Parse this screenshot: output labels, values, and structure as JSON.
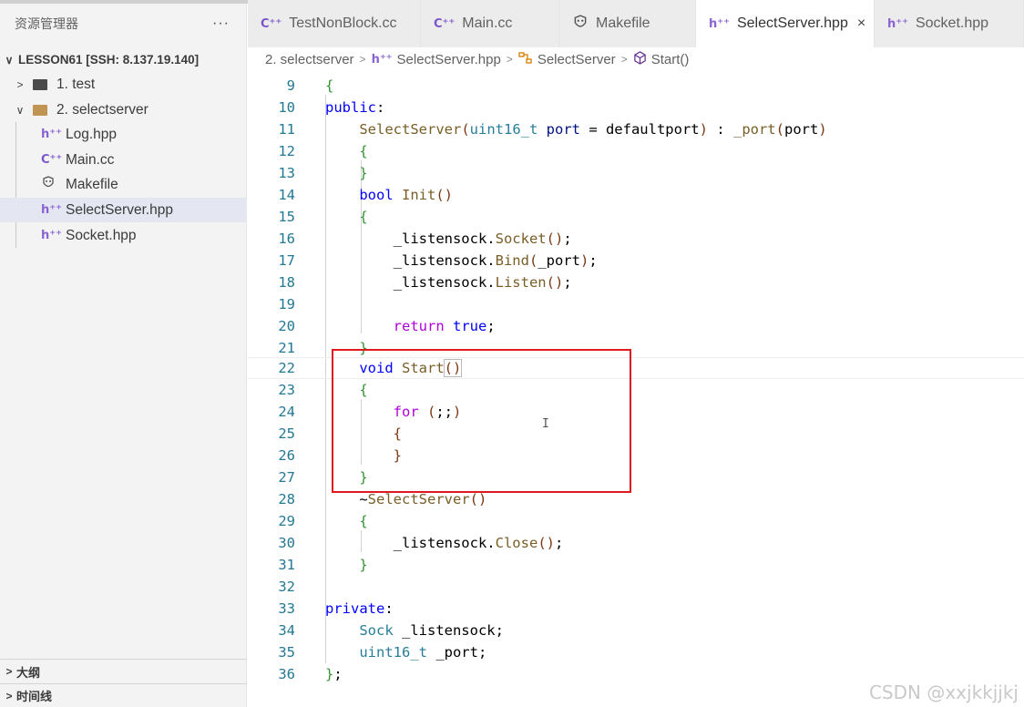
{
  "sidebar": {
    "title": "资源管理器",
    "more": "···",
    "workspace": "LESSON61 [SSH: 8.137.19.140]",
    "items": [
      {
        "label": "1. test"
      },
      {
        "label": "2. selectserver"
      },
      {
        "label": "Log.hpp"
      },
      {
        "label": "Main.cc"
      },
      {
        "label": "Makefile"
      },
      {
        "label": "SelectServer.hpp"
      },
      {
        "label": "Socket.hpp"
      }
    ],
    "outline": "大纲",
    "timeline": "时间线"
  },
  "tabs": [
    {
      "label": "TestNonBlock.cc",
      "icon": "C⁺⁺"
    },
    {
      "label": "Main.cc",
      "icon": "C⁺⁺"
    },
    {
      "label": "Makefile",
      "icon": "makefile-icon"
    },
    {
      "label": "SelectServer.hpp",
      "icon": "h⁺⁺",
      "active": true
    },
    {
      "label": "Socket.hpp",
      "icon": "h⁺⁺"
    }
  ],
  "breadcrumb": {
    "folder": "2. selectserver",
    "file": "SelectServer.hpp",
    "class": "SelectServer",
    "method": "Start()"
  },
  "icons": {
    "cpp": "C⁺⁺",
    "hpp": "h⁺⁺",
    "close": "×",
    "chev_right": ">",
    "chev_down": "∨",
    "cursor": "I"
  },
  "editor": {
    "line_numbers": [
      "9",
      "10",
      "11",
      "12",
      "13",
      "14",
      "15",
      "16",
      "17",
      "18",
      "19",
      "20",
      "21",
      "22",
      "23",
      "24",
      "25",
      "26",
      "27",
      "28",
      "29",
      "30",
      "31",
      "32",
      "33",
      "34",
      "35",
      "36"
    ],
    "current_line": "22"
  },
  "watermark": "CSDN @xxjkkjjkj",
  "colors": {
    "highlight_box": "#e0191f",
    "keyword": "#0000ff",
    "control": "#af00db",
    "type": "#267f99",
    "function": "#795e26",
    "line_number": "#237893"
  }
}
